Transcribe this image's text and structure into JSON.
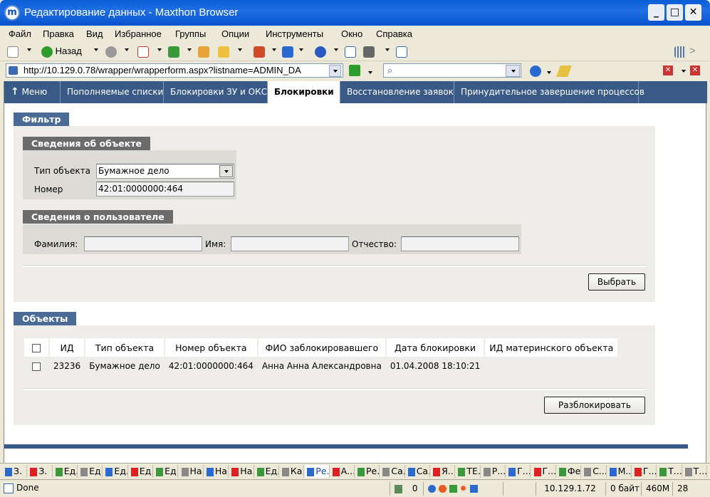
{
  "window": {
    "title": "Редактирование данных - Maxthon Browser",
    "icon_letter": "m",
    "min": "_",
    "max": "□",
    "close": "✕"
  },
  "menu": [
    "Файл",
    "Правка",
    "Вид",
    "Избранное",
    "Группы",
    "Опции",
    "Инструменты",
    "Окно",
    "Справка"
  ],
  "toolbar": {
    "back_label": "Назад"
  },
  "address": {
    "url": "http://10.129.0.78/wrapper/wrapperform.aspx?listname=ADMIN_DA"
  },
  "nav": {
    "items": [
      "Меню",
      "Пополняемые списки",
      "Блокировки ЗУ и ОКС",
      "Блокировки",
      "Восстановление заявок",
      "Принудительное завершение процессов"
    ],
    "active_index": 3
  },
  "filter": {
    "header": "Фильтр",
    "object_section": {
      "header": "Сведения об объекте",
      "type_label": "Тип объекта",
      "type_value": "Бумажное дело",
      "number_label": "Номер",
      "number_value": "42:01:0000000:464"
    },
    "user_section": {
      "header": "Сведения о пользователе",
      "lastname_label": "Фамилия:",
      "firstname_label": "Имя:",
      "middlename_label": "Отчество:",
      "lastname_value": "",
      "firstname_value": "",
      "middlename_value": ""
    },
    "select_button": "Выбрать"
  },
  "objects": {
    "header": "Объекты",
    "columns": [
      "ИД",
      "Тип объекта",
      "Номер объекта",
      "ФИО заблокировавшего",
      "Дата блокировки",
      "ИД материнского объекта"
    ],
    "rows": [
      {
        "id": "23236",
        "type": "Бумажное дело",
        "number": "42:01:0000000:464",
        "fio": "Анна Анна Александровна",
        "date": "01.04.2008 18:10:21",
        "parent_id": ""
      }
    ],
    "unlock_button": "Разблокировать"
  },
  "tasks": [
    "З.",
    "З.",
    "Ед...",
    "Ед...",
    "Ед...",
    "Ед...",
    "Ед...",
    "На...",
    "На...",
    "На...",
    "Ед...",
    "Ка...",
    "Ре...",
    "А...",
    "Ре...",
    "Са...",
    "Са...",
    "Я...",
    "ТЕ...",
    "Р...",
    "Г...",
    "Г...",
    "Фе...",
    "С...",
    "М...",
    "Г...",
    "Т...",
    "Т..."
  ],
  "active_task_index": 12,
  "status": {
    "text": "Done",
    "count": "0",
    "ip": "10.129.1.72",
    "bytes": "0 байт",
    "memory": "460M",
    "number": "28"
  },
  "colors": {
    "nav_bar": "#395a86",
    "panel": "#efedea",
    "header_blue": "#4a6b96",
    "header_gray": "#6b6b6b"
  }
}
